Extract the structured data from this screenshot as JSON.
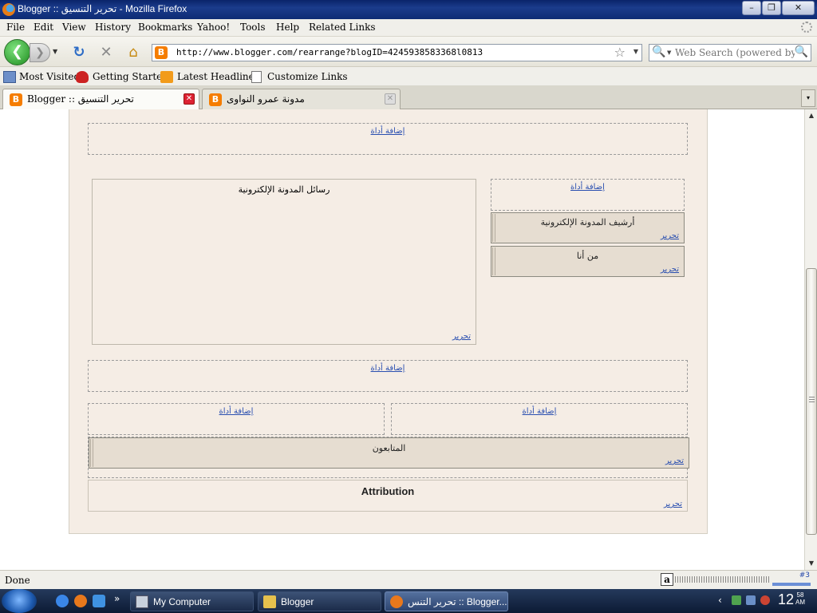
{
  "window": {
    "title": "Blogger :: تحرير التنسيق - Mozilla Firefox",
    "controls": {
      "minimize": "–",
      "maximize": "❐",
      "close": "✕"
    }
  },
  "menu": {
    "items": [
      "File",
      "Edit",
      "View",
      "History",
      "Bookmarks",
      "Yahoo!",
      "Tools",
      "Help",
      "Related Links"
    ]
  },
  "nav": {
    "url": "http://www.blogger.com/rearrange?blogID=4245938583368l0813",
    "search_placeholder": "Web Search (powered by Go",
    "icons": {
      "back": "back-arrow-icon",
      "forward": "forward-arrow-icon",
      "reload": "reload-icon",
      "stop": "stop-icon",
      "home": "home-icon",
      "bookmark_star": "star-icon",
      "search": "magnifier-icon"
    },
    "glyphs": {
      "back": "❮",
      "forward": "❯",
      "reload": "↻",
      "stop": "✕",
      "home": "⌂",
      "star": "☆",
      "dropdown": "▼",
      "magnifier": "🔍"
    }
  },
  "bookmarks": {
    "items": [
      "Most Visited",
      "Getting Started",
      "Latest Headlines",
      "Customize Links"
    ]
  },
  "tabs": [
    {
      "label": "Blogger :: تحرير التنسيق",
      "close": "✕"
    },
    {
      "label": "مدونة عمرو النواوى",
      "close": "✕"
    }
  ],
  "tablist_glyph": "▾",
  "layout_editor": {
    "add_gadget": "إضافة أداة",
    "edit": "تحرير",
    "posts_title": "رسائل المدونة الإلكترونية",
    "archive_title": "أرشيف المدونة الإلكترونية",
    "about_title": "من أنا",
    "followers_title": "المتابعون",
    "attribution_title": "Attribution"
  },
  "status": {
    "text": "Done",
    "alexa_letter": "a",
    "rank_text": "#3"
  },
  "scrollbar": {
    "up": "▲",
    "down": "▼"
  },
  "taskbar": {
    "buttons": [
      "My Computer",
      "Blogger",
      "تحرير التنس :: Blogger..."
    ],
    "more": "»",
    "clock": "12",
    "clock_minutes": "58",
    "clock_ampm": "AM",
    "tray_chevron": "‹"
  }
}
